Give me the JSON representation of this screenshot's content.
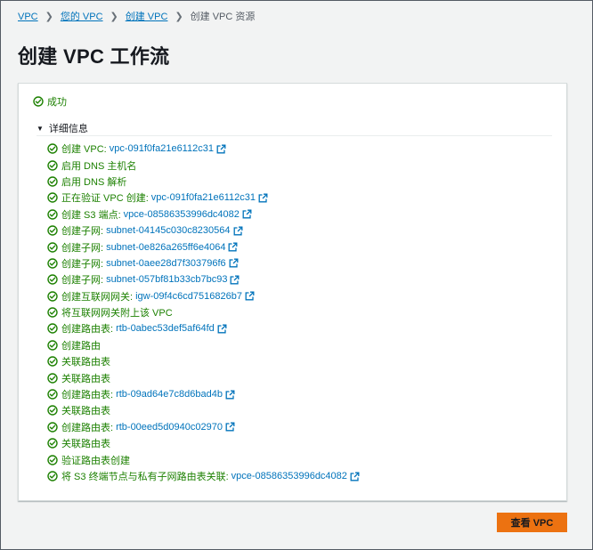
{
  "breadcrumb": {
    "items": [
      "VPC",
      "您的 VPC",
      "创建 VPC"
    ],
    "current": "创建 VPC 资源"
  },
  "page_title": "创建 VPC 工作流",
  "status": {
    "label": "成功"
  },
  "details": {
    "label": "详细信息"
  },
  "steps": [
    {
      "text": "创建 VPC:",
      "link": "vpc-091f0fa21e6112c31"
    },
    {
      "text": "启用 DNS 主机名",
      "link": null
    },
    {
      "text": "启用 DNS 解析",
      "link": null
    },
    {
      "text": "正在验证 VPC 创建:",
      "link": "vpc-091f0fa21e6112c31"
    },
    {
      "text": "创建 S3 端点:",
      "link": "vpce-08586353996dc4082"
    },
    {
      "text": "创建子网:",
      "link": "subnet-04145c030c8230564"
    },
    {
      "text": "创建子网:",
      "link": "subnet-0e826a265ff6e4064"
    },
    {
      "text": "创建子网:",
      "link": "subnet-0aee28d7f303796f6"
    },
    {
      "text": "创建子网:",
      "link": "subnet-057bf81b33cb7bc93"
    },
    {
      "text": "创建互联网网关:",
      "link": "igw-09f4c6cd7516826b7"
    },
    {
      "text": "将互联网网关附上该 VPC",
      "link": null
    },
    {
      "text": "创建路由表:",
      "link": "rtb-0abec53def5af64fd"
    },
    {
      "text": "创建路由",
      "link": null
    },
    {
      "text": "关联路由表",
      "link": null
    },
    {
      "text": "关联路由表",
      "link": null
    },
    {
      "text": "创建路由表:",
      "link": "rtb-09ad64e7c8d6bad4b"
    },
    {
      "text": "关联路由表",
      "link": null
    },
    {
      "text": "创建路由表:",
      "link": "rtb-00eed5d0940c02970"
    },
    {
      "text": "关联路由表",
      "link": null
    },
    {
      "text": "验证路由表创建",
      "link": null
    },
    {
      "text": "将 S3 终端节点与私有子网路由表关联:",
      "link": "vpce-08586353996dc4082"
    }
  ],
  "actions": {
    "view_vpc": "查看 VPC"
  },
  "colors": {
    "success": "#1d8102",
    "link": "#0073bb",
    "primary_button": "#ec7211",
    "background": "#f2f3f3"
  },
  "icons": {
    "status": "check-circle-icon",
    "external": "external-link-icon",
    "expand": "caret-down-icon",
    "separator": "chevron-right-icon"
  }
}
